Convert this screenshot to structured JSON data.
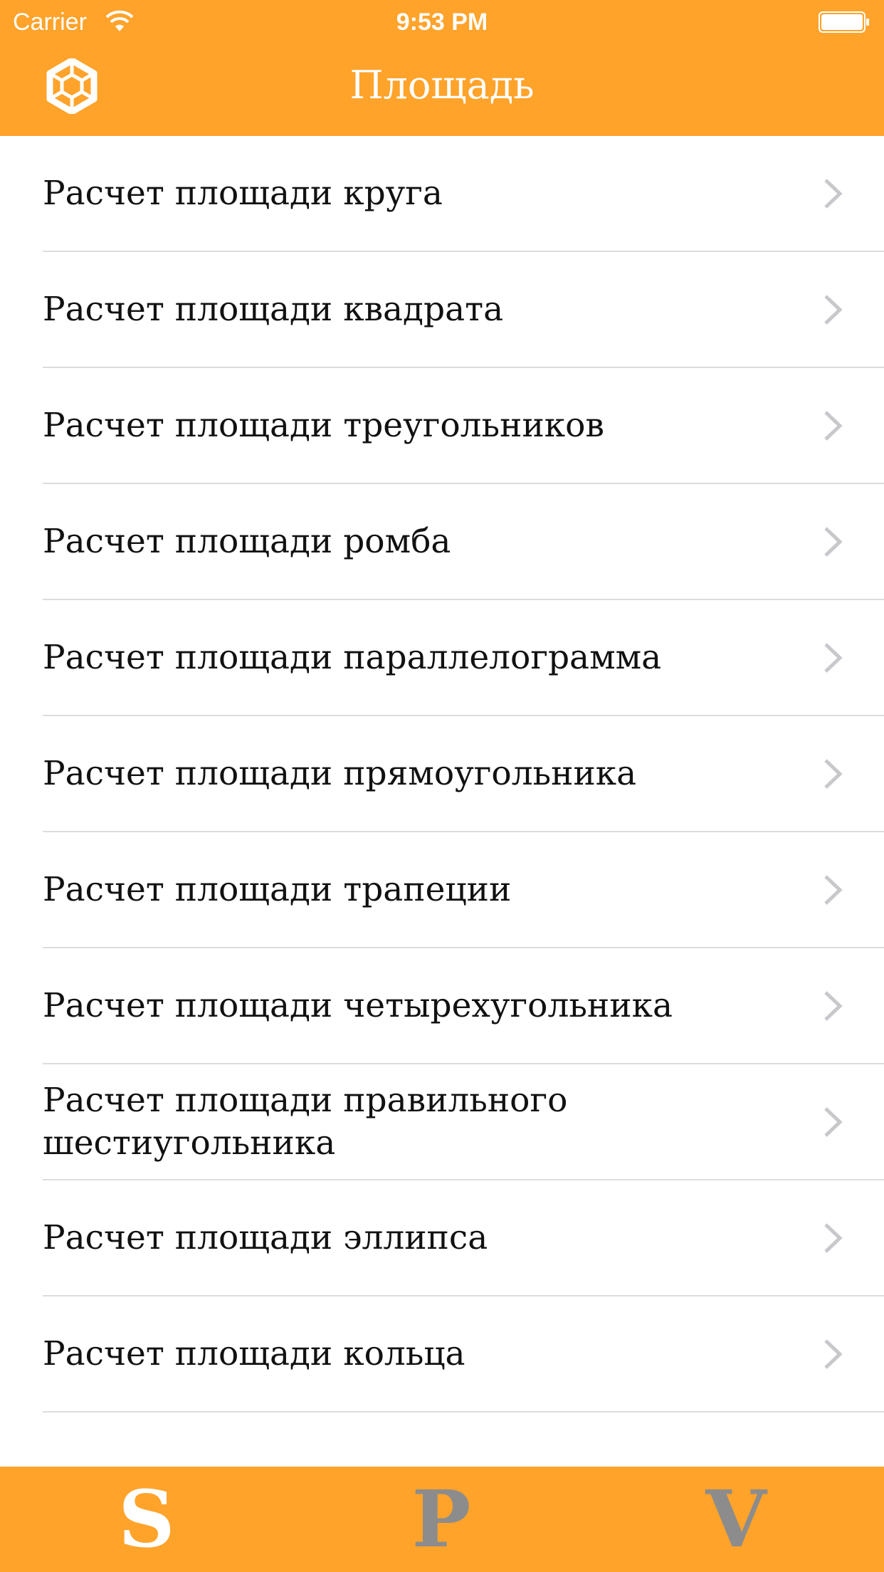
{
  "status_bar": {
    "carrier": "Carrier",
    "time": "9:53 PM"
  },
  "nav": {
    "title": "Площадь",
    "icon": "hexagon-icon"
  },
  "list": {
    "items": [
      {
        "label": "Расчет площади круга"
      },
      {
        "label": "Расчет площади квадрата"
      },
      {
        "label": "Расчет площади треугольников"
      },
      {
        "label": "Расчет площади ромба"
      },
      {
        "label": "Расчет площади параллелограмма"
      },
      {
        "label": "Расчет площади прямоугольника"
      },
      {
        "label": "Расчет площади трапеции"
      },
      {
        "label": "Расчет площади четырехугольника"
      },
      {
        "label": "Расчет площади правильного шестиугольника"
      },
      {
        "label": "Расчет площади эллипса"
      },
      {
        "label": "Расчет площади кольца"
      }
    ]
  },
  "tab_bar": {
    "tabs": [
      {
        "label": "S",
        "active": true
      },
      {
        "label": "P",
        "active": false
      },
      {
        "label": "V",
        "active": false
      }
    ]
  },
  "colors": {
    "accent": "#ffa32b",
    "tab_active": "#ffffff",
    "tab_inactive": "#8c8c8c",
    "chevron": "#c7c7cc",
    "separator": "#dcdcdc"
  }
}
